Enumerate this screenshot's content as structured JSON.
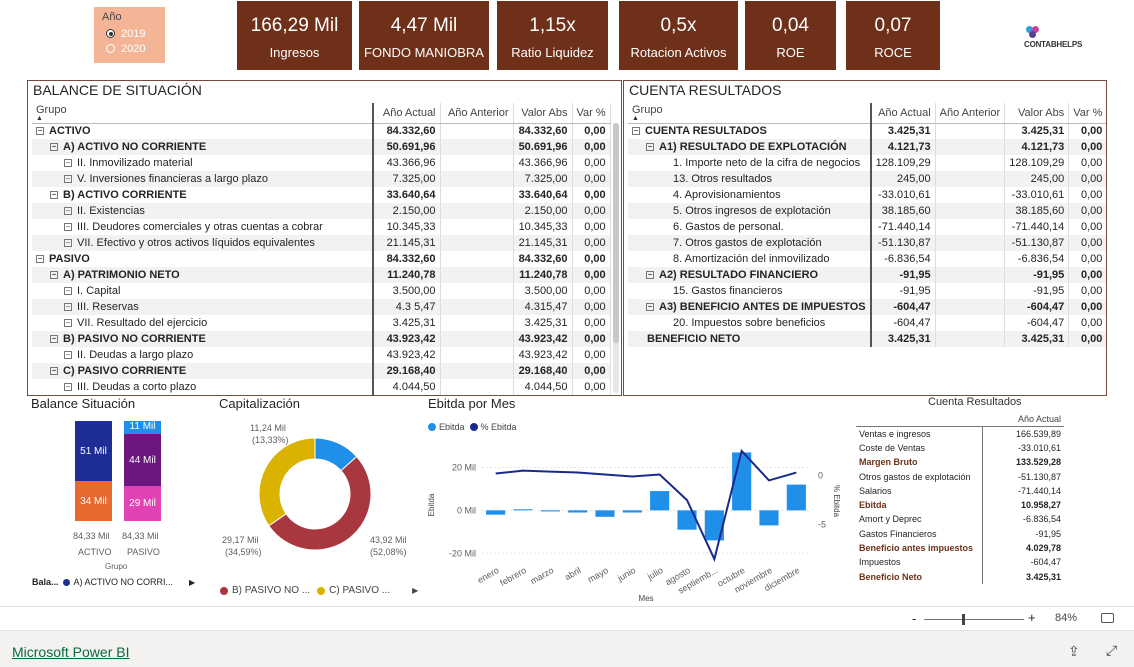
{
  "slicer": {
    "title": "Año",
    "options": [
      {
        "label": "2019",
        "selected": true
      },
      {
        "label": "2020",
        "selected": false
      }
    ]
  },
  "kpis": [
    {
      "value": "166,29 Mil",
      "label": "Ingresos"
    },
    {
      "value": "4,47 Mil",
      "label": "FONDO MANIOBRA"
    },
    {
      "value": "1,15x",
      "label": "Ratio Liquidez"
    },
    {
      "value": "0,5x",
      "label": "Rotacion Activos"
    },
    {
      "value": "0,04",
      "label": "ROE"
    },
    {
      "value": "0,07",
      "label": "ROCE"
    }
  ],
  "logo": {
    "text": "CONTABHELPS"
  },
  "balance": {
    "title": "BALANCE DE SITUACIÓN",
    "headers": [
      "Grupo",
      "Año Actual",
      "Año Anterior",
      "Valor Abs",
      "Var %"
    ],
    "rows": [
      {
        "level": 0,
        "label": "ACTIVO",
        "actual": "84.332,60",
        "anterior": "",
        "abs": "84.332,60",
        "var": "0,00",
        "bold": true,
        "expand": true
      },
      {
        "level": 1,
        "label": "A) ACTIVO NO CORRIENTE",
        "actual": "50.691,96",
        "anterior": "",
        "abs": "50.691,96",
        "var": "0,00",
        "bold": true,
        "expand": true
      },
      {
        "level": 2,
        "label": "II. Inmovilizado material",
        "actual": "43.366,96",
        "anterior": "",
        "abs": "43.366,96",
        "var": "0,00",
        "bold": false,
        "expand": true
      },
      {
        "level": 2,
        "label": "V. Inversiones financieras a largo plazo",
        "actual": "7.325,00",
        "anterior": "",
        "abs": "7.325,00",
        "var": "0,00",
        "bold": false,
        "expand": true
      },
      {
        "level": 1,
        "label": "B) ACTIVO CORRIENTE",
        "actual": "33.640,64",
        "anterior": "",
        "abs": "33.640,64",
        "var": "0,00",
        "bold": true,
        "expand": true
      },
      {
        "level": 2,
        "label": "II. Existencias",
        "actual": "2.150,00",
        "anterior": "",
        "abs": "2.150,00",
        "var": "0,00",
        "bold": false,
        "expand": true
      },
      {
        "level": 2,
        "label": "III. Deudores comerciales y otras cuentas a cobrar",
        "actual": "10.345,33",
        "anterior": "",
        "abs": "10.345,33",
        "var": "0,00",
        "bold": false,
        "expand": true
      },
      {
        "level": 2,
        "label": "VII. Efectivo y otros activos líquidos equivalentes",
        "actual": "21.145,31",
        "anterior": "",
        "abs": "21.145,31",
        "var": "0,00",
        "bold": false,
        "expand": true
      },
      {
        "level": 0,
        "label": "PASIVO",
        "actual": "84.332,60",
        "anterior": "",
        "abs": "84.332,60",
        "var": "0,00",
        "bold": true,
        "expand": true
      },
      {
        "level": 1,
        "label": "A) PATRIMONIO NETO",
        "actual": "11.240,78",
        "anterior": "",
        "abs": "11.240,78",
        "var": "0,00",
        "bold": true,
        "expand": true
      },
      {
        "level": 2,
        "label": "I. Capital",
        "actual": "3.500,00",
        "anterior": "",
        "abs": "3.500,00",
        "var": "0,00",
        "bold": false,
        "expand": true
      },
      {
        "level": 2,
        "label": "III. Reservas",
        "actual": "4.3  5,47",
        "anterior": "",
        "abs": "4.315,47",
        "var": "0,00",
        "bold": false,
        "expand": true
      },
      {
        "level": 2,
        "label": "VII. Resultado del ejercicio",
        "actual": "3.425,31",
        "anterior": "",
        "abs": "3.425,31",
        "var": "0,00",
        "bold": false,
        "expand": true
      },
      {
        "level": 1,
        "label": "B) PASIVO NO CORRIENTE",
        "actual": "43.923,42",
        "anterior": "",
        "abs": "43.923,42",
        "var": "0,00",
        "bold": true,
        "expand": true
      },
      {
        "level": 2,
        "label": "II. Deudas a largo plazo",
        "actual": "43.923,42",
        "anterior": "",
        "abs": "43.923,42",
        "var": "0,00",
        "bold": false,
        "expand": true
      },
      {
        "level": 1,
        "label": "C) PASIVO CORRIENTE",
        "actual": "29.168,40",
        "anterior": "",
        "abs": "29.168,40",
        "var": "0,00",
        "bold": true,
        "expand": true
      },
      {
        "level": 2,
        "label": "III. Deudas a corto plazo",
        "actual": "4.044,50",
        "anterior": "",
        "abs": "4.044,50",
        "var": "0,00",
        "bold": false,
        "expand": true
      }
    ]
  },
  "resultados": {
    "title": "CUENTA RESULTADOS",
    "headers": [
      "Grupo",
      "Año Actual",
      "Año Anterior",
      "Valor Abs",
      "Var %"
    ],
    "rows": [
      {
        "level": 0,
        "label": "CUENTA RESULTADOS",
        "actual": "3.425,31",
        "anterior": "",
        "abs": "3.425,31",
        "var": "0,00",
        "bold": true,
        "expand": true
      },
      {
        "level": 1,
        "label": "A1) RESULTADO DE EXPLOTACIÓN",
        "actual": "4.121,73",
        "anterior": "",
        "abs": "4.121,73",
        "var": "0,00",
        "bold": true,
        "expand": true
      },
      {
        "level": 2,
        "label": "1. Importe neto de la cifra de negocios",
        "actual": "128.109,29",
        "anterior": "",
        "abs": "128.109,29",
        "var": "0,00",
        "bold": false,
        "expand": false
      },
      {
        "level": 2,
        "label": "13. Otros resultados",
        "actual": "245,00",
        "anterior": "",
        "abs": "245,00",
        "var": "0,00",
        "bold": false,
        "expand": false
      },
      {
        "level": 2,
        "label": "4. Aprovisionamientos",
        "actual": "-33.010,61",
        "anterior": "",
        "abs": "-33.010,61",
        "var": "0,00",
        "bold": false,
        "expand": false
      },
      {
        "level": 2,
        "label": "5. Otros ingresos de explotación",
        "actual": "38.185,60",
        "anterior": "",
        "abs": "38.185,60",
        "var": "0,00",
        "bold": false,
        "expand": false
      },
      {
        "level": 2,
        "label": "6. Gastos de personal.",
        "actual": "-71.440,14",
        "anterior": "",
        "abs": "-71.440,14",
        "var": "0,00",
        "bold": false,
        "expand": false
      },
      {
        "level": 2,
        "label": "7. Otros gastos de explotación",
        "actual": "-51.130,87",
        "anterior": "",
        "abs": "-51.130,87",
        "var": "0,00",
        "bold": false,
        "expand": false
      },
      {
        "level": 2,
        "label": "8. Amortización del inmovilizado",
        "actual": "-6.836,54",
        "anterior": "",
        "abs": "-6.836,54",
        "var": "0,00",
        "bold": false,
        "expand": false
      },
      {
        "level": 1,
        "label": "A2) RESULTADO FINANCIERO",
        "actual": "-91,95",
        "anterior": "",
        "abs": "-91,95",
        "var": "0,00",
        "bold": true,
        "expand": true
      },
      {
        "level": 2,
        "label": "15. Gastos financieros",
        "actual": "-91,95",
        "anterior": "",
        "abs": "-91,95",
        "var": "0,00",
        "bold": false,
        "expand": false
      },
      {
        "level": 1,
        "label": "A3) BENEFICIO ANTES DE IMPUESTOS",
        "actual": "-604,47",
        "anterior": "",
        "abs": "-604,47",
        "var": "0,00",
        "bold": true,
        "expand": true
      },
      {
        "level": 2,
        "label": "20. Impuestos sobre beneficios",
        "actual": "-604,47",
        "anterior": "",
        "abs": "-604,47",
        "var": "0,00",
        "bold": false,
        "expand": false
      },
      {
        "level": 0,
        "label": "BENEFICIO NETO",
        "actual": "3.425,31",
        "anterior": "",
        "abs": "3.425,31",
        "var": "0,00",
        "bold": true,
        "expand": false
      }
    ]
  },
  "balance_chart": {
    "title": "Balance Situación",
    "xlabel": "Grupo",
    "legend_prefix": "Bala...",
    "legend_item": "A) ACTIVO NO CORRI...",
    "legend_color": "#1f2d96",
    "columns": [
      {
        "label": "ACTIVO",
        "total": "84,33 Mil",
        "segments": [
          {
            "label": "51 Mil",
            "value": 50.69,
            "color": "#1f2d96"
          },
          {
            "label": "34 Mil",
            "value": 33.64,
            "color": "#e8692f"
          }
        ]
      },
      {
        "label": "PASIVO",
        "total": "84,33 Mil",
        "segments": [
          {
            "label": "11 Mil",
            "value": 11.24,
            "color": "#1f8fea"
          },
          {
            "label": "44 Mil",
            "value": 43.92,
            "color": "#6c1680"
          },
          {
            "label": "29 Mil",
            "value": 29.17,
            "color": "#e242b4"
          }
        ]
      }
    ]
  },
  "capitalizacion": {
    "title": "Capitalización",
    "slices": [
      {
        "value": 43.92,
        "color": "#a8373f",
        "label": "43,92 Mil",
        "pct": "(52,08%)"
      },
      {
        "value": 29.17,
        "color": "#d9b300",
        "label": "29,17 Mil",
        "pct": "(34,59%)"
      },
      {
        "value": 11.24,
        "color": "#1f8fea",
        "label": "11,24 Mil",
        "pct": "(13,33%)"
      }
    ],
    "legend": [
      {
        "label": "B) PASIVO NO ...",
        "color": "#a8373f"
      },
      {
        "label": "C) PASIVO ...",
        "color": "#d9b300"
      }
    ]
  },
  "chart_data": {
    "type": "bar",
    "title": "Ebitda por Mes",
    "xlabel": "Mes",
    "ylabel": "Ebitda",
    "y2label": "% Ebitda",
    "categories": [
      "enero",
      "febrero",
      "marzo",
      "abril",
      "mayo",
      "junio",
      "julio",
      "agosto",
      "septiemb...",
      "octubre",
      "noviembre",
      "diciembre"
    ],
    "series": [
      {
        "name": "Ebitda",
        "type": "bar",
        "color": "#1f8fea",
        "values": [
          -2,
          0.5,
          -0.5,
          -1,
          -3,
          -1,
          9,
          -9,
          -14,
          27,
          -7,
          12
        ]
      },
      {
        "name": "% Ebitda",
        "type": "line",
        "color": "#1a2a8c",
        "values": [
          0.2,
          0.5,
          0.4,
          0.3,
          0.1,
          -0.1,
          0.1,
          -2.5,
          -8.5,
          2.5,
          -0.5,
          0.3
        ]
      }
    ],
    "ylim": [
      -25,
      30
    ],
    "y2lim": [
      -9,
      3
    ],
    "yticks": [
      {
        "value": 20,
        "label": "20 Mil"
      },
      {
        "value": 0,
        "label": "0 Mil"
      },
      {
        "value": -20,
        "label": "-20 Mil"
      }
    ],
    "y2ticks": [
      {
        "value": 0,
        "label": "0"
      },
      {
        "value": -5,
        "label": "-5"
      }
    ]
  },
  "summary": {
    "title": "Cuenta Resultados",
    "header": "Año Actual",
    "rows": [
      {
        "label": "Ventas e ingresos",
        "value": "166.539,89",
        "bold": false
      },
      {
        "label": "Coste de Ventas",
        "value": "-33.010,61",
        "bold": false
      },
      {
        "label": "Margen Bruto",
        "value": "133.529,28",
        "bold": true
      },
      {
        "label": "Otros gastos de explotación",
        "value": "-51.130,87",
        "bold": false
      },
      {
        "label": "Salarios",
        "value": "-71.440,14",
        "bold": false
      },
      {
        "label": "Ebitda",
        "value": "10.958,27",
        "bold": true
      },
      {
        "label": "Amort y Deprec",
        "value": "-6.836,54",
        "bold": false
      },
      {
        "label": "Gastos Financieros",
        "value": "-91,95",
        "bold": false
      },
      {
        "label": "Beneficio antes impuestos",
        "value": "4.029,78",
        "bold": true
      },
      {
        "label": "Impuestos",
        "value": "-604,47",
        "bold": false
      },
      {
        "label": "Beneficio Neto",
        "value": "3.425,31",
        "bold": true
      }
    ]
  },
  "zoom": {
    "minus": "-",
    "plus": "+",
    "level": "84%"
  },
  "footer": {
    "brand": "Microsoft Power BI"
  }
}
